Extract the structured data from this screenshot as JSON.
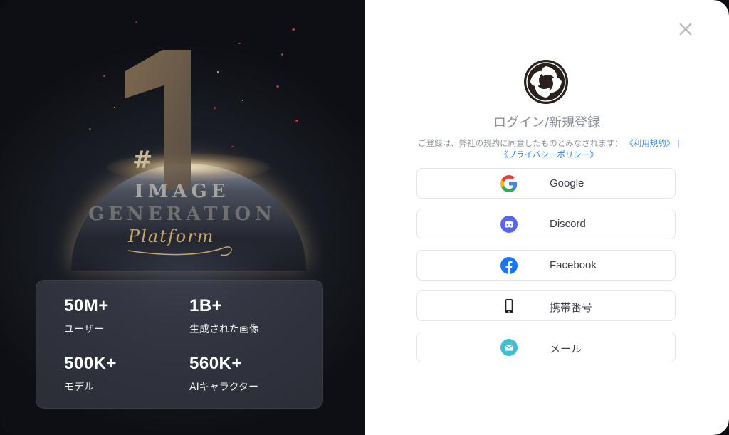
{
  "promo": {
    "hero_hash": "#",
    "hero_line1": "IMAGE",
    "hero_line2": "GENERATION",
    "hero_line3": "Platform",
    "stats": [
      {
        "value": "50M+",
        "label": "ユーザー"
      },
      {
        "value": "1B+",
        "label": "生成された画像"
      },
      {
        "value": "500K+",
        "label": "モデル"
      },
      {
        "value": "560K+",
        "label": "AIキャラクター"
      }
    ]
  },
  "login": {
    "title": "ログイン/新規登録",
    "terms_text": "ご登録は、弊社の規約に同意したものとみなされます：",
    "terms_link": "《利用規約》",
    "terms_sep": "|",
    "privacy_link": "《プライバシーポリシー》",
    "buttons": [
      {
        "label": "Google",
        "icon": "google-icon"
      },
      {
        "label": "Discord",
        "icon": "discord-icon"
      },
      {
        "label": "Facebook",
        "icon": "facebook-icon"
      },
      {
        "label": "携帯番号",
        "icon": "phone-icon"
      },
      {
        "label": "メール",
        "icon": "mail-icon"
      }
    ]
  },
  "colors": {
    "accent_link": "#2f88e8",
    "discord": "#5865F2",
    "facebook": "#1877F2",
    "mail": "#3fc1d4"
  }
}
